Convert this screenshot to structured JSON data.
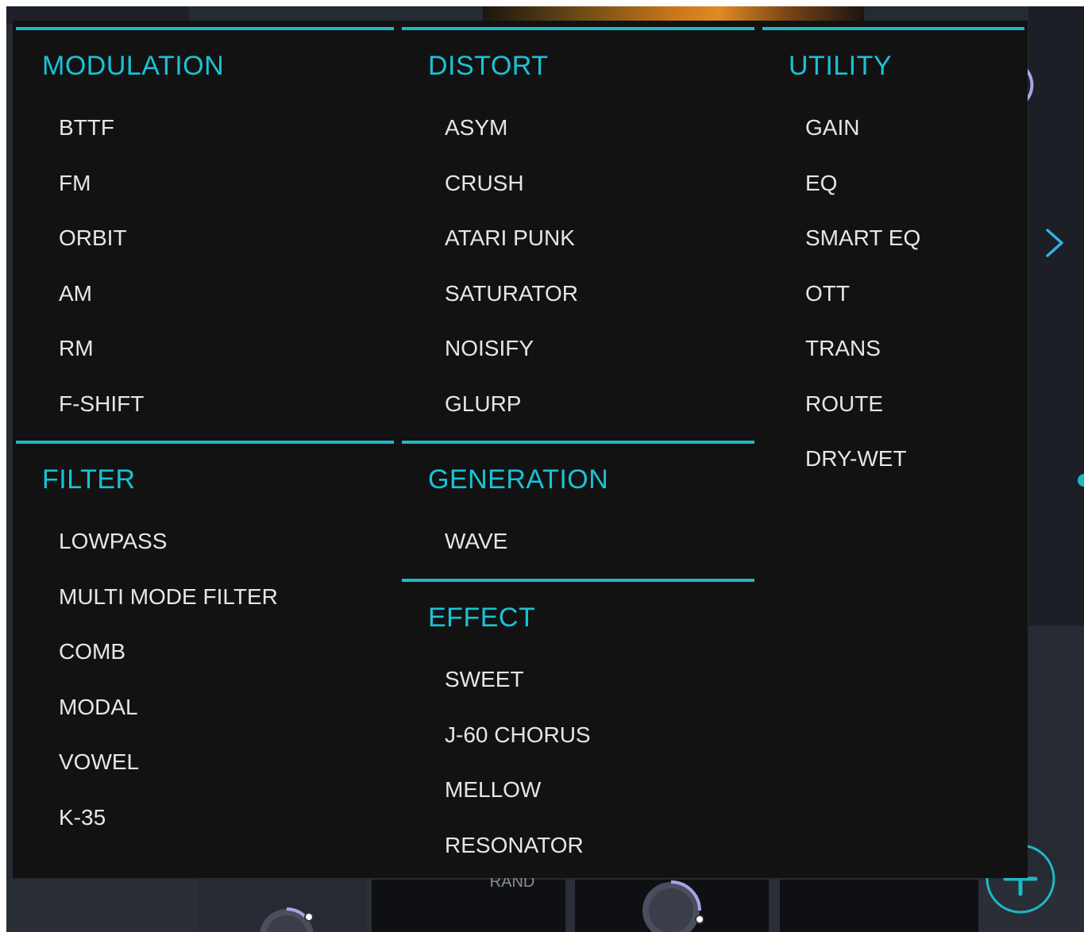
{
  "colors": {
    "accent": "#19c3d6",
    "rule": "#1fb8c4",
    "menu_bg": "#121212",
    "item_text": "#e6e6e6"
  },
  "menu": {
    "modulation": {
      "title": "MODULATION",
      "items": [
        "BTTF",
        "FM",
        "ORBIT",
        "AM",
        "RM",
        "F-SHIFT"
      ]
    },
    "distort": {
      "title": "DISTORT",
      "items": [
        "ASYM",
        "CRUSH",
        "ATARI PUNK",
        "SATURATOR",
        "NOISIFY",
        "GLURP"
      ]
    },
    "utility": {
      "title": "UTILITY",
      "items": [
        "GAIN",
        "EQ",
        "SMART EQ",
        "OTT",
        "TRANS",
        "ROUTE",
        "DRY-WET"
      ]
    },
    "filter": {
      "title": "FILTER",
      "items": [
        "LOWPASS",
        "MULTI MODE FILTER",
        "COMB",
        "MODAL",
        "VOWEL",
        "K-35"
      ]
    },
    "generation": {
      "title": "GENERATION",
      "items": [
        "WAVE"
      ]
    },
    "effect": {
      "title": "EFFECT",
      "items": [
        "SWEET",
        "J-60 CHORUS",
        "MELLOW",
        "RESONATOR"
      ]
    }
  },
  "background": {
    "rand_label": "RAND"
  },
  "icons": {
    "scroll": "chevron-right-icon",
    "add": "plus-icon",
    "knob": "knob-icon"
  }
}
